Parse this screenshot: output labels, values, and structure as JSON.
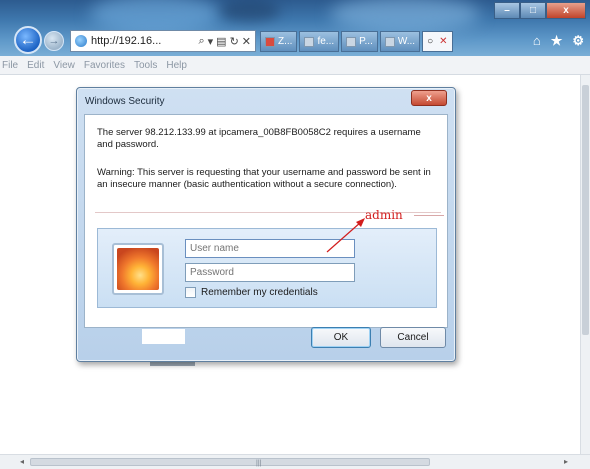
{
  "browser": {
    "address_text": "http://192.16...",
    "address_tools": [
      "⌕",
      "▾",
      "▤",
      "↻",
      "✕"
    ],
    "tabs": [
      {
        "label": "Z..."
      },
      {
        "label": "fe..."
      },
      {
        "label": "P..."
      },
      {
        "label": "W..."
      },
      {
        "label": "",
        "close": "✕"
      }
    ],
    "window_buttons": [
      "–",
      "□",
      "x"
    ],
    "right_icons": [
      "⌂",
      "★",
      "⚙"
    ],
    "menu": [
      "File",
      "Edit",
      "View",
      "Favorites",
      "Tools",
      "Help"
    ]
  },
  "dialog": {
    "title": "Windows Security",
    "close_label": "x",
    "message": "The server 98.212.133.99 at ipcamera_00B8FB0058C2 requires a username and password.",
    "warning": "Warning: This server is requesting that your username and password be sent in an insecure manner (basic authentication without a secure connection).",
    "username_placeholder": "User name",
    "password_placeholder": "Password",
    "remember_label": "Remember my credentials",
    "ok_label": "OK",
    "cancel_label": "Cancel"
  },
  "annotation": {
    "text": "admin",
    "color": "#d21d1d"
  },
  "colors": {
    "titlebar": "#3e77ad",
    "dialog_frame": "#b8d0ea",
    "close_button": "#c44a32"
  }
}
